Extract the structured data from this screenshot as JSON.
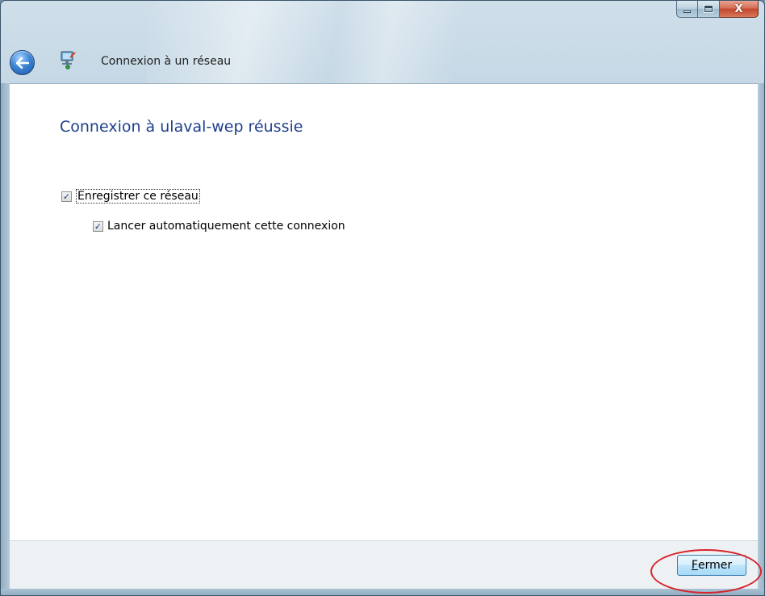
{
  "window": {
    "caption_buttons": {
      "minimize_icon": "minimize-icon",
      "maximize_icon": "maximize-icon",
      "close_glyph": "X"
    }
  },
  "nav": {
    "back_icon": "back-arrow-icon",
    "app_icon": "network-icon",
    "title": "Connexion à un réseau"
  },
  "main": {
    "heading": "Connexion à ulaval-wep réussie",
    "options": [
      {
        "label": "Enregistrer ce réseau",
        "checked": true
      },
      {
        "label": "Lancer automatiquement cette connexion",
        "checked": true
      }
    ]
  },
  "footer": {
    "close_button": {
      "access_key": "F",
      "rest": "ermer"
    }
  },
  "colors": {
    "heading": "#1e3f8c",
    "annotation": "#d8232a",
    "button_border": "#3c7fb1"
  }
}
